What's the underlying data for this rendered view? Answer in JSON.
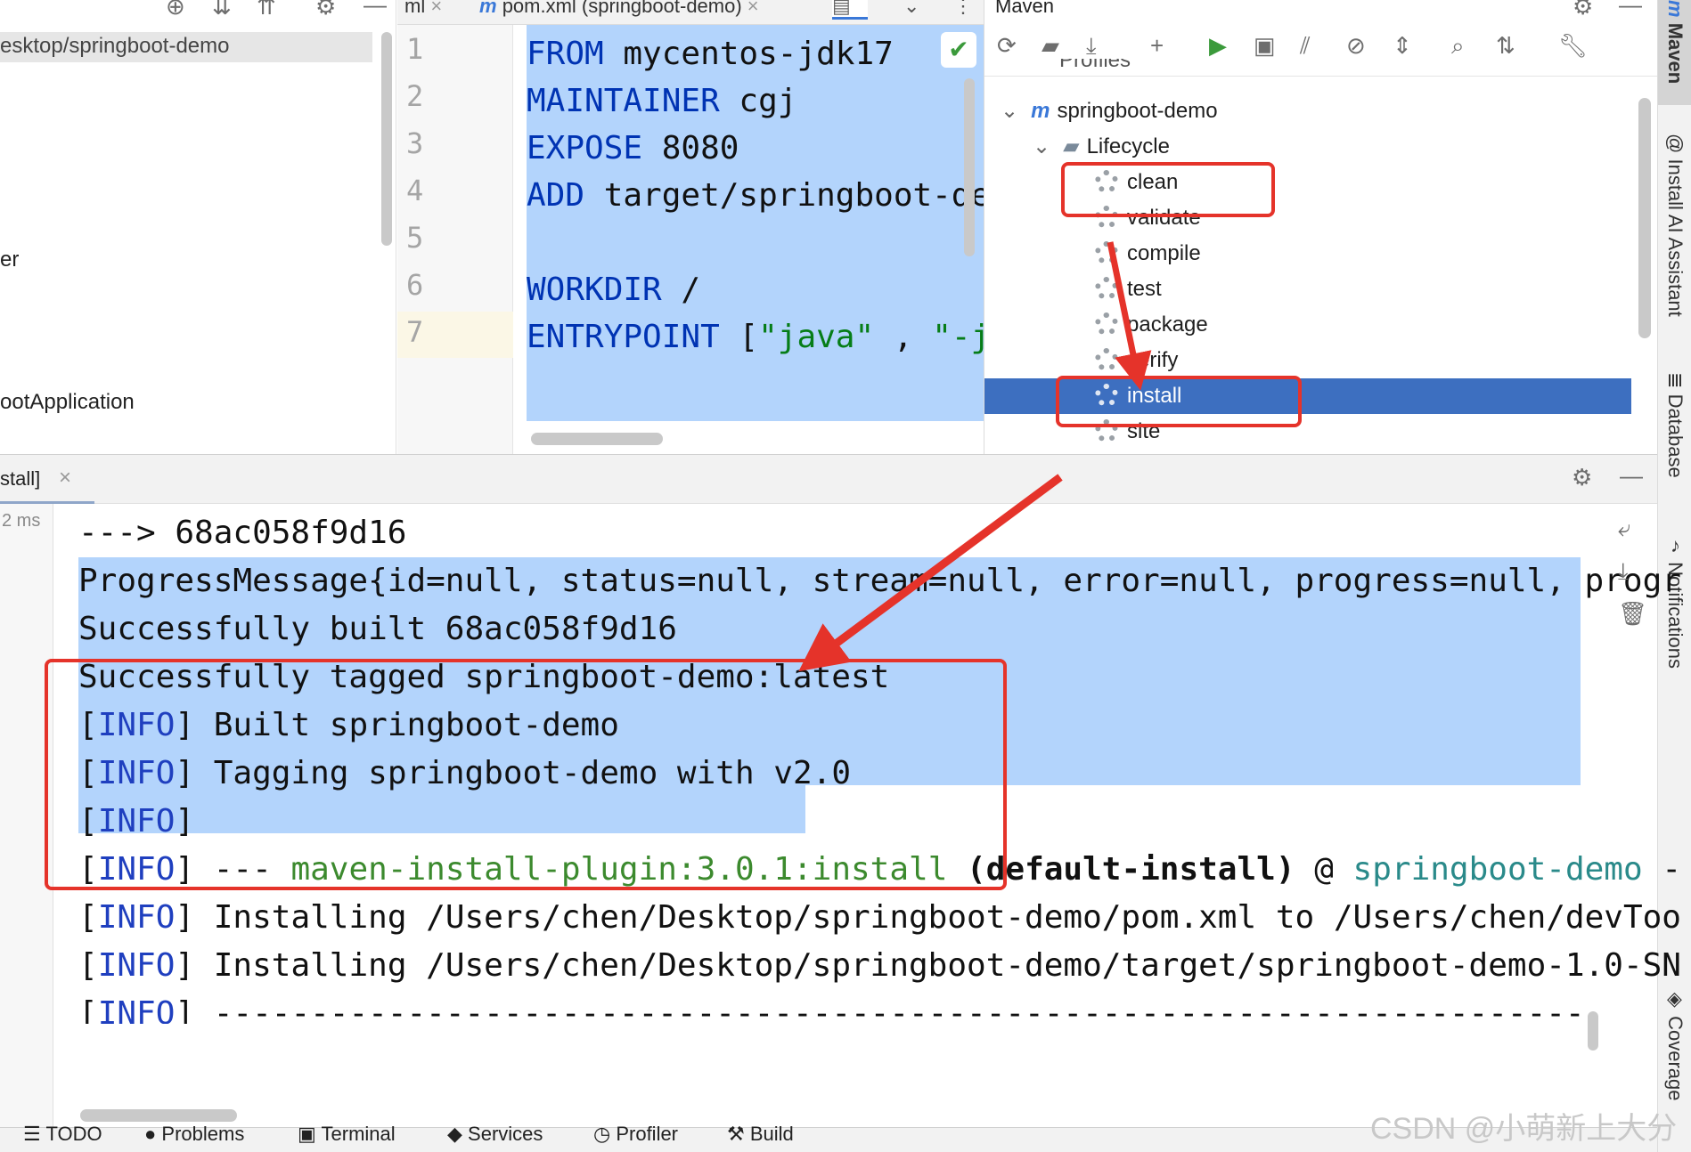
{
  "left_panel": {
    "path": "esktop/springboot-demo",
    "item_er": "er",
    "item_app": "ootApplication"
  },
  "editor": {
    "tab_ml": "ml",
    "tab_pom": "pom.xml (springboot-demo)",
    "line_numbers": [
      "1",
      "2",
      "3",
      "4",
      "5",
      "6",
      "7"
    ],
    "lines": {
      "l1_kw": "FROM",
      "l1_rest": " mycentos-jdk17",
      "l2_kw": "MAINTAINER",
      "l2_rest": " cgj",
      "l3_kw": "EXPOSE",
      "l3_rest": " 8080",
      "l4_kw": "ADD",
      "l4_rest": " target/springboot-dem",
      "l6_kw": "WORKDIR",
      "l6_rest": " /",
      "l7_kw": "ENTRYPOINT",
      "l7_a": " [",
      "l7_s1": "\"java\"",
      "l7_b": " , ",
      "l7_s2": "\"-ja"
    }
  },
  "maven": {
    "title": "Maven",
    "profiles": "Profiles",
    "project": "springboot-demo",
    "lifecycle": "Lifecycle",
    "goals": [
      "clean",
      "validate",
      "compile",
      "test",
      "package",
      "verify",
      "install",
      "site"
    ],
    "selected_goal": "install"
  },
  "right_strip": {
    "maven": "Maven",
    "ai": "Install AI Assistant",
    "database": "Database",
    "notifications": "Notifications",
    "coverage": "Coverage"
  },
  "run": {
    "tab_label": "stall]",
    "time": "2 ms",
    "lines": {
      "c1": " ---> 68ac058f9d16",
      "c2": "ProgressMessage{id=null, status=null, stream=null, error=null, progress=null, progr",
      "c3": "Successfully built 68ac058f9d16",
      "c4": "Successfully tagged springboot-demo:latest",
      "info": "INFO",
      "c5": " Built springboot-demo",
      "c6": " Tagging springboot-demo with v2.0",
      "c8_a": " --- ",
      "c8_plugin": "maven-install-plugin:3.0.1:install",
      "c8_b": " (default-install)",
      "c8_c": " @ ",
      "c8_proj": "springboot-demo",
      "c8_d": " -",
      "c9": " Installing /Users/chen/Desktop/springboot-demo/pom.xml to /Users/chen/devToo",
      "c10": " Installing /Users/chen/Desktop/springboot-demo/target/springboot-demo-1.0-SN",
      "c11": " ------------------------------------------------------------------------"
    }
  },
  "bottom_bar": {
    "todo": "TODO",
    "problems": "Problems",
    "terminal": "Terminal",
    "services": "Services",
    "profiler": "Profiler",
    "build": "Build"
  },
  "watermark": "CSDN @小萌新上大分",
  "colors": {
    "selection": "#b3d4fc",
    "selected_row": "#3d6fc0",
    "annotation_red": "#e5332a",
    "keyword": "#0033b3",
    "info": "#1f3fbf"
  }
}
